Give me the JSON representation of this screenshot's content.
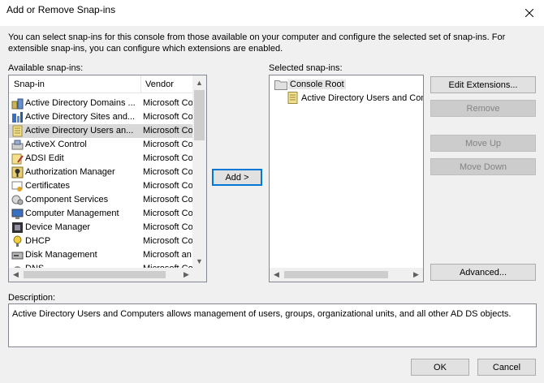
{
  "window": {
    "title": "Add or Remove Snap-ins",
    "close_icon": "close-icon"
  },
  "intro": "You can select snap-ins for this console from those available on your computer and configure the selected set of snap-ins. For extensible snap-ins, you can configure which extensions are enabled.",
  "available": {
    "label": "Available snap-ins:",
    "columns": {
      "name": "Snap-in",
      "vendor": "Vendor"
    },
    "items": [
      {
        "name": "Active Directory Domains ...",
        "vendor": "Microsoft Co",
        "icon": "ad-domains-icon"
      },
      {
        "name": "Active Directory Sites and...",
        "vendor": "Microsoft Co",
        "icon": "ad-sites-icon"
      },
      {
        "name": "Active Directory Users an...",
        "vendor": "Microsoft Co",
        "icon": "ad-users-icon",
        "selected": true
      },
      {
        "name": "ActiveX Control",
        "vendor": "Microsoft Co",
        "icon": "activex-icon"
      },
      {
        "name": "ADSI Edit",
        "vendor": "Microsoft Co",
        "icon": "adsi-edit-icon"
      },
      {
        "name": "Authorization Manager",
        "vendor": "Microsoft Co",
        "icon": "authorization-icon"
      },
      {
        "name": "Certificates",
        "vendor": "Microsoft Co",
        "icon": "certificates-icon"
      },
      {
        "name": "Component Services",
        "vendor": "Microsoft Co",
        "icon": "component-services-icon"
      },
      {
        "name": "Computer Management",
        "vendor": "Microsoft Co",
        "icon": "computer-management-icon"
      },
      {
        "name": "Device Manager",
        "vendor": "Microsoft Co",
        "icon": "device-manager-icon"
      },
      {
        "name": "DHCP",
        "vendor": "Microsoft Co",
        "icon": "dhcp-icon"
      },
      {
        "name": "Disk Management",
        "vendor": "Microsoft an",
        "icon": "disk-management-icon"
      },
      {
        "name": "DNS",
        "vendor": "Microsoft Co",
        "icon": "dns-icon"
      }
    ]
  },
  "add_button": "Add >",
  "selected": {
    "label": "Selected snap-ins:",
    "root": "Console Root",
    "child": "Active Directory Users and Com"
  },
  "buttons": {
    "edit_extensions": "Edit Extensions...",
    "remove": "Remove",
    "move_up": "Move Up",
    "move_down": "Move Down",
    "advanced": "Advanced...",
    "ok": "OK",
    "cancel": "Cancel"
  },
  "description": {
    "label": "Description:",
    "text": "Active Directory Users and Computers allows management of users, groups, organizational units, and all other AD DS objects."
  },
  "colors": {
    "selection": "#d9d9d9",
    "focus_border": "#0078d7",
    "accent_folder": "#e6c86e"
  }
}
